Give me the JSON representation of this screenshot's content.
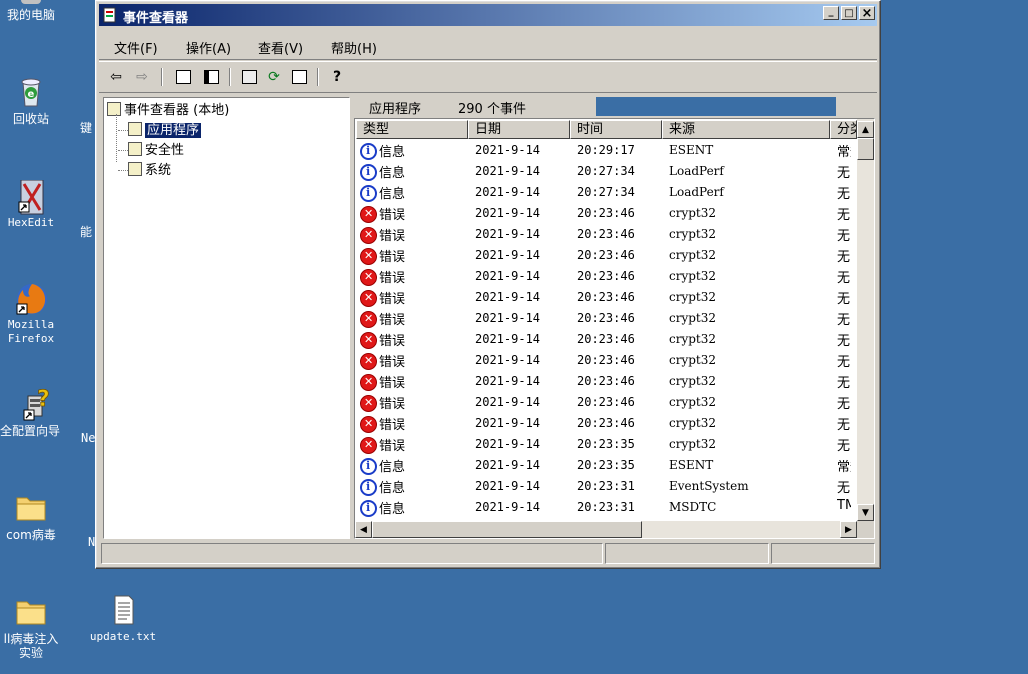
{
  "desktop": {
    "icons": [
      {
        "name": "my-computer",
        "label": "我的电脑"
      },
      {
        "name": "recycle-bin",
        "label": "回收站"
      },
      {
        "name": "hexedit",
        "label": "HexEdit"
      },
      {
        "name": "firefox",
        "label": "Mozilla Firefox"
      },
      {
        "name": "security-wizard",
        "label": "全配置向导"
      },
      {
        "name": "com-virus-folder",
        "label": "com病毒"
      },
      {
        "name": "dll-folder",
        "label": "ll病毒注入 实验"
      },
      {
        "name": "update-txt",
        "label": "update.txt"
      }
    ],
    "partial_labels": {
      "jian": "键",
      "neng": "能",
      "ne": "Ne",
      "n": "N"
    }
  },
  "window": {
    "title": "事件查看器",
    "buttons": {
      "minimize": "_",
      "maximize": "□",
      "close": "×"
    }
  },
  "menu": [
    "文件(F)",
    "操作(A)",
    "查看(V)",
    "帮助(H)"
  ],
  "tree": {
    "root": "事件查看器 (本地)",
    "items": [
      "应用程序",
      "安全性",
      "系统"
    ],
    "selected_index": 0
  },
  "pane": {
    "title": "应用程序",
    "count": "290 个事件"
  },
  "columns": [
    "类型",
    "日期",
    "时间",
    "来源",
    "分类"
  ],
  "events": [
    {
      "type": "info",
      "label": "信息",
      "date": "2021-9-14",
      "time": "20:29:17",
      "source": "ESENT",
      "cat": "常规"
    },
    {
      "type": "info",
      "label": "信息",
      "date": "2021-9-14",
      "time": "20:27:34",
      "source": "LoadPerf",
      "cat": "无"
    },
    {
      "type": "info",
      "label": "信息",
      "date": "2021-9-14",
      "time": "20:27:34",
      "source": "LoadPerf",
      "cat": "无"
    },
    {
      "type": "error",
      "label": "错误",
      "date": "2021-9-14",
      "time": "20:23:46",
      "source": "crypt32",
      "cat": "无"
    },
    {
      "type": "error",
      "label": "错误",
      "date": "2021-9-14",
      "time": "20:23:46",
      "source": "crypt32",
      "cat": "无"
    },
    {
      "type": "error",
      "label": "错误",
      "date": "2021-9-14",
      "time": "20:23:46",
      "source": "crypt32",
      "cat": "无"
    },
    {
      "type": "error",
      "label": "错误",
      "date": "2021-9-14",
      "time": "20:23:46",
      "source": "crypt32",
      "cat": "无"
    },
    {
      "type": "error",
      "label": "错误",
      "date": "2021-9-14",
      "time": "20:23:46",
      "source": "crypt32",
      "cat": "无"
    },
    {
      "type": "error",
      "label": "错误",
      "date": "2021-9-14",
      "time": "20:23:46",
      "source": "crypt32",
      "cat": "无"
    },
    {
      "type": "error",
      "label": "错误",
      "date": "2021-9-14",
      "time": "20:23:46",
      "source": "crypt32",
      "cat": "无"
    },
    {
      "type": "error",
      "label": "错误",
      "date": "2021-9-14",
      "time": "20:23:46",
      "source": "crypt32",
      "cat": "无"
    },
    {
      "type": "error",
      "label": "错误",
      "date": "2021-9-14",
      "time": "20:23:46",
      "source": "crypt32",
      "cat": "无"
    },
    {
      "type": "error",
      "label": "错误",
      "date": "2021-9-14",
      "time": "20:23:46",
      "source": "crypt32",
      "cat": "无"
    },
    {
      "type": "error",
      "label": "错误",
      "date": "2021-9-14",
      "time": "20:23:46",
      "source": "crypt32",
      "cat": "无"
    },
    {
      "type": "error",
      "label": "错误",
      "date": "2021-9-14",
      "time": "20:23:35",
      "source": "crypt32",
      "cat": "无"
    },
    {
      "type": "info",
      "label": "信息",
      "date": "2021-9-14",
      "time": "20:23:35",
      "source": "ESENT",
      "cat": "常规"
    },
    {
      "type": "info",
      "label": "信息",
      "date": "2021-9-14",
      "time": "20:23:31",
      "source": "EventSystem",
      "cat": "无"
    },
    {
      "type": "info",
      "label": "信息",
      "date": "2021-9-14",
      "time": "20:23:31",
      "source": "MSDTC",
      "cat": "TM"
    }
  ],
  "colors": {
    "desktop": "#3a6ea5",
    "title_start": "#0a246a",
    "title_end": "#a6caf0",
    "error": "#e01818",
    "info": "#1a3cc8"
  }
}
